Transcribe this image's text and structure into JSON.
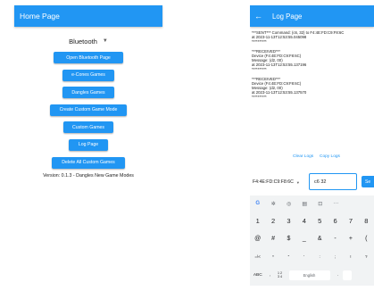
{
  "home": {
    "title": "Home Page",
    "device_dropdown": {
      "value": "Bluetooth"
    },
    "buttons": [
      "Open Bluetooth Page",
      "e-Cones Games",
      "Dangles Games",
      "Create Custom Game Mode",
      "Custom Games",
      "Log Page",
      "Delete All Custom Games"
    ],
    "version_text": "Version: 0.1.3 - Dangles New Game Modes"
  },
  "log": {
    "title": "Log Page",
    "entries": [
      {
        "lines": [
          "***SENT*** Command: (c6, 32) to F4:4E:FD:C9:F8:6C",
          "at 2023-11-13T12:53:55.045098",
          "**********"
        ]
      },
      {
        "lines": [
          "***RECEIVED***",
          "Device (F4:4E:FD:C9:F8:6C)",
          "Message: (d2, 00)",
          "at 2023-11-13T12:53:55.137196",
          "**********"
        ]
      },
      {
        "lines": [
          "***RECEIVED***",
          "Device (F4:4E:FD:C9:F8:6C)",
          "Message: (d2, 00)",
          "at 2023-11-13T12:53:55.137570",
          "**********"
        ]
      }
    ],
    "clear_logs_label": "Clear Logs",
    "copy_logs_label": "Copy Logs",
    "device_select_value": "F4:4E:FD:C9:F8:6C",
    "command_input_value": "c6 32",
    "send_label": "Se"
  },
  "keyboard": {
    "toolbar": [
      "G",
      "✲",
      "◎",
      "▤",
      "⊡",
      "···"
    ],
    "row_numbers": [
      "1",
      "2",
      "3",
      "4",
      "5",
      "6",
      "7",
      "8",
      "9"
    ],
    "row_symbols": [
      "@",
      "#",
      "$",
      "_",
      "&",
      "-",
      "+",
      "(",
      ")"
    ],
    "row_more": [
      "=\\<",
      "*",
      "\"",
      "'",
      ":",
      ";",
      "!",
      "?",
      ""
    ],
    "abc_label": "ABC",
    "comma_label": ",",
    "alt_label": "1 2\n3 4",
    "space_label": "English",
    "period_label": "."
  }
}
